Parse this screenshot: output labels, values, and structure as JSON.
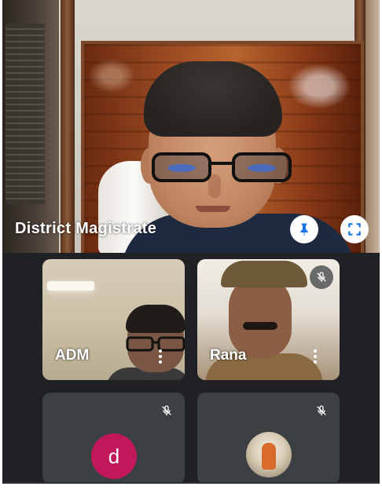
{
  "main": {
    "presenter_label": "District Magistrate",
    "pin_icon": "pin-icon",
    "fullscreen_icon": "fullscreen-icon"
  },
  "participants": [
    {
      "label": "ADM",
      "more_icon": "more-vert-icon"
    },
    {
      "label": "Rana",
      "mic_icon": "mic-off-icon",
      "more_icon": "more-vert-icon"
    },
    {
      "avatar_letter": "d",
      "avatar_color": "#c2185b",
      "mic_icon": "mic-off-icon"
    },
    {
      "avatar": "profile-photo",
      "mic_icon": "mic-off-icon"
    }
  ],
  "colors": {
    "background": "#202124",
    "tile": "#3c4043",
    "accent_blue": "#1a73e8"
  }
}
